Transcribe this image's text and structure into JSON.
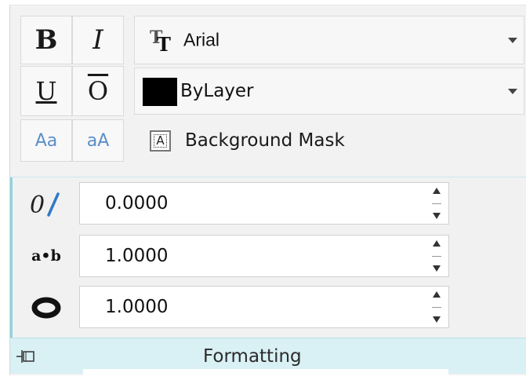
{
  "toolbar": {
    "bold_label": "B",
    "italic_label": "I",
    "underline_label": "U",
    "overline_label": "O",
    "case_lower_label": "Aa",
    "case_upper_label": "aA"
  },
  "font_combo": {
    "value": "Arial",
    "icon": "truetype-font-icon"
  },
  "color_combo": {
    "value": "ByLayer",
    "swatch_color": "#000000"
  },
  "background_mask": {
    "label": "Background Mask",
    "icon": "background-mask-icon"
  },
  "properties": {
    "oblique_angle": {
      "icon": "oblique-angle-icon",
      "icon_text": "0/",
      "value": "0.0000"
    },
    "tracking": {
      "icon": "tracking-icon",
      "icon_text": "a•b",
      "value": "1.0000"
    },
    "width_factor": {
      "icon": "width-factor-icon",
      "value": "1.0000"
    }
  },
  "panel": {
    "title": "Formatting",
    "accent_color": "#8fd3df",
    "footer_color": "#d9f0f4"
  }
}
